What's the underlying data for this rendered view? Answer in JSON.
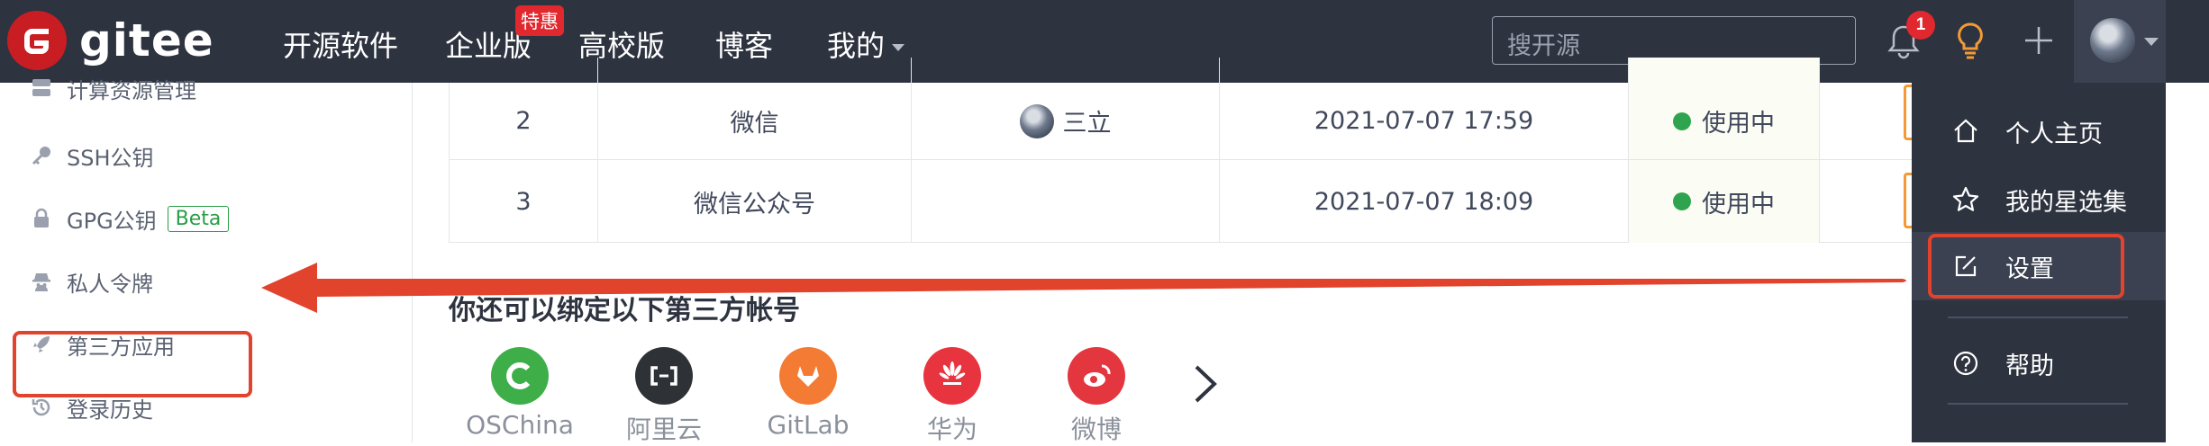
{
  "nav": {
    "brand": "gitee",
    "items": [
      "开源软件",
      "企业版",
      "高校版",
      "博客",
      "我的"
    ],
    "hot_badge": "特惠",
    "search_placeholder": "搜开源",
    "notification_count": "1"
  },
  "sidebar": {
    "items": [
      {
        "label": "计算资源管理",
        "icon": "server-icon"
      },
      {
        "label": "SSH公钥",
        "icon": "key-icon"
      },
      {
        "label": "GPG公钥",
        "icon": "lock-icon",
        "badge": "Beta"
      },
      {
        "label": "私人令牌",
        "icon": "spy-icon"
      },
      {
        "label": "第三方应用",
        "icon": "rocket-icon"
      },
      {
        "label": "登录历史",
        "icon": "history-icon"
      }
    ]
  },
  "table": {
    "rows": [
      {
        "index": "2",
        "name": "微信",
        "creator": "三立",
        "time": "2021-07-07 17:59",
        "status": "使用中"
      },
      {
        "index": "3",
        "name": "微信公众号",
        "creator": "",
        "time": "2021-07-07 18:09",
        "status": "使用中"
      }
    ]
  },
  "third_party": {
    "title": "你还可以绑定以下第三方帐号",
    "accounts": [
      {
        "label": "OSChina",
        "color": "#3eae49",
        "icon": "oschina-icon"
      },
      {
        "label": "阿里云",
        "color": "#2e3136",
        "icon": "aliyun-icon"
      },
      {
        "label": "GitLab",
        "color": "#f37b34",
        "icon": "gitlab-icon"
      },
      {
        "label": "华为",
        "color": "#e8343f",
        "icon": "huawei-icon"
      },
      {
        "label": "微博",
        "color": "#e4363f",
        "icon": "weibo-icon"
      }
    ]
  },
  "dropdown": {
    "items": [
      {
        "label": "个人主页",
        "icon": "home-icon"
      },
      {
        "label": "我的星选集",
        "icon": "star-icon"
      },
      {
        "label": "设置",
        "icon": "edit-icon"
      },
      {
        "label": "帮助",
        "icon": "help-icon"
      }
    ]
  },
  "colors": {
    "topbar": "#2e3340",
    "highlight": "#e1432c",
    "status_green": "#2ea44f",
    "brand_red": "#c71d23"
  }
}
